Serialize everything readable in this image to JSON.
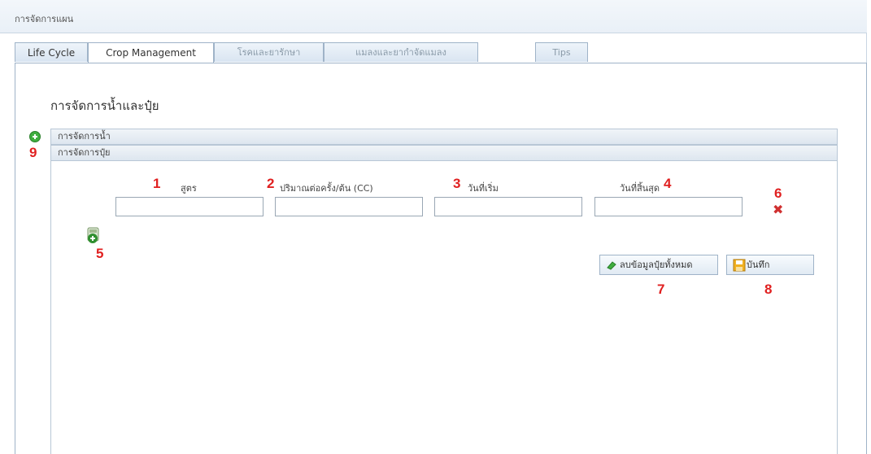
{
  "window": {
    "title": "การจัดการแผน"
  },
  "tabs": [
    {
      "label": "Life Cycle"
    },
    {
      "label": "Crop Management"
    },
    {
      "label": "โรคและยารักษา"
    },
    {
      "label": "แมลงและยากำจัดแมลง"
    },
    {
      "label": "Tips"
    }
  ],
  "section": {
    "title": "การจัดการน้ำและปุ๋ย"
  },
  "accordion": {
    "water_header": "การจัดการน้ำ",
    "fertilizer_header": "การจัดการปุ๋ย"
  },
  "fields": [
    {
      "number": "1",
      "label": "สูตร",
      "value": ""
    },
    {
      "number": "2",
      "label": "ปริมาณต่อครั้ง/ต้น (CC)",
      "value": ""
    },
    {
      "number": "3",
      "label": "วันที่เริ่ม",
      "value": ""
    },
    {
      "number": "4",
      "label": "วันที่สิ้นสุด",
      "value": ""
    }
  ],
  "annotations": {
    "add": "5",
    "delete": "6",
    "clear_all": "7",
    "save": "8",
    "expand": "9"
  },
  "buttons": {
    "clear_all_label": "ลบข้อมูลปุ๋ยทั้งหมด",
    "save_label": "บันทึก"
  },
  "colors": {
    "annotation": "#e02020",
    "accent": "#3fae3f",
    "border": "#9fb3c8"
  },
  "icons": {
    "expand": "plus-circle-icon",
    "add_row": "add-fertilizer-icon",
    "delete_row": "delete-x-icon",
    "clear": "eraser-icon",
    "save": "floppy-disk-icon"
  }
}
